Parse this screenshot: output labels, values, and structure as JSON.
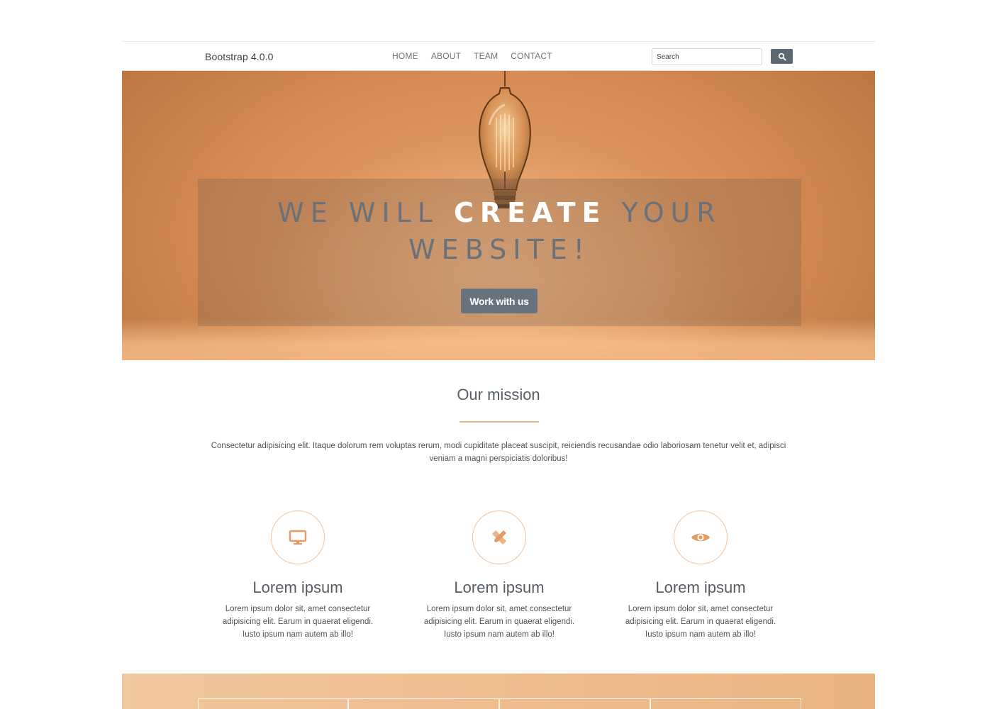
{
  "navbar": {
    "brand": "Bootstrap 4.0.0",
    "links": [
      "HOME",
      "ABOUT",
      "TEAM",
      "CONTACT"
    ],
    "search_placeholder": "Search",
    "search_icon": "magnifier-icon"
  },
  "hero": {
    "title_part1": "WE WILL ",
    "title_highlight": "CREATE",
    "title_part2": " YOUR",
    "title_line2": "WEBSITE!",
    "cta_label": "Work with us",
    "image": "light-bulb"
  },
  "mission": {
    "title": "Our mission",
    "text": "Consectetur adipisicing elit. Itaque dolorum rem voluptas rerum, modi cupiditate placeat suscipit, reiciendis recusandae odio laboriosam tenetur velit et, adipisci veniam a magni perspiciatis doloribus!"
  },
  "features": [
    {
      "icon": "monitor-icon",
      "title": "Lorem ipsum",
      "text": "Lorem ipsum dolor sit, amet consectetur adipisicing elit. Earum in quaerat eligendi. Iusto ipsum nam autem ab illo!"
    },
    {
      "icon": "design-tools-icon",
      "title": "Lorem ipsum",
      "text": "Lorem ipsum dolor sit, amet consectetur adipisicing elit. Earum in quaerat eligendi. Iusto ipsum nam autem ab illo!"
    },
    {
      "icon": "eye-icon",
      "title": "Lorem ipsum",
      "text": "Lorem ipsum dolor sit, amet consectetur adipisicing elit. Earum in quaerat eligendi. Iusto ipsum nam autem ab illo!"
    }
  ],
  "colors": {
    "accent": "#e9a977",
    "button": "#68727c",
    "text": "#555d66"
  }
}
